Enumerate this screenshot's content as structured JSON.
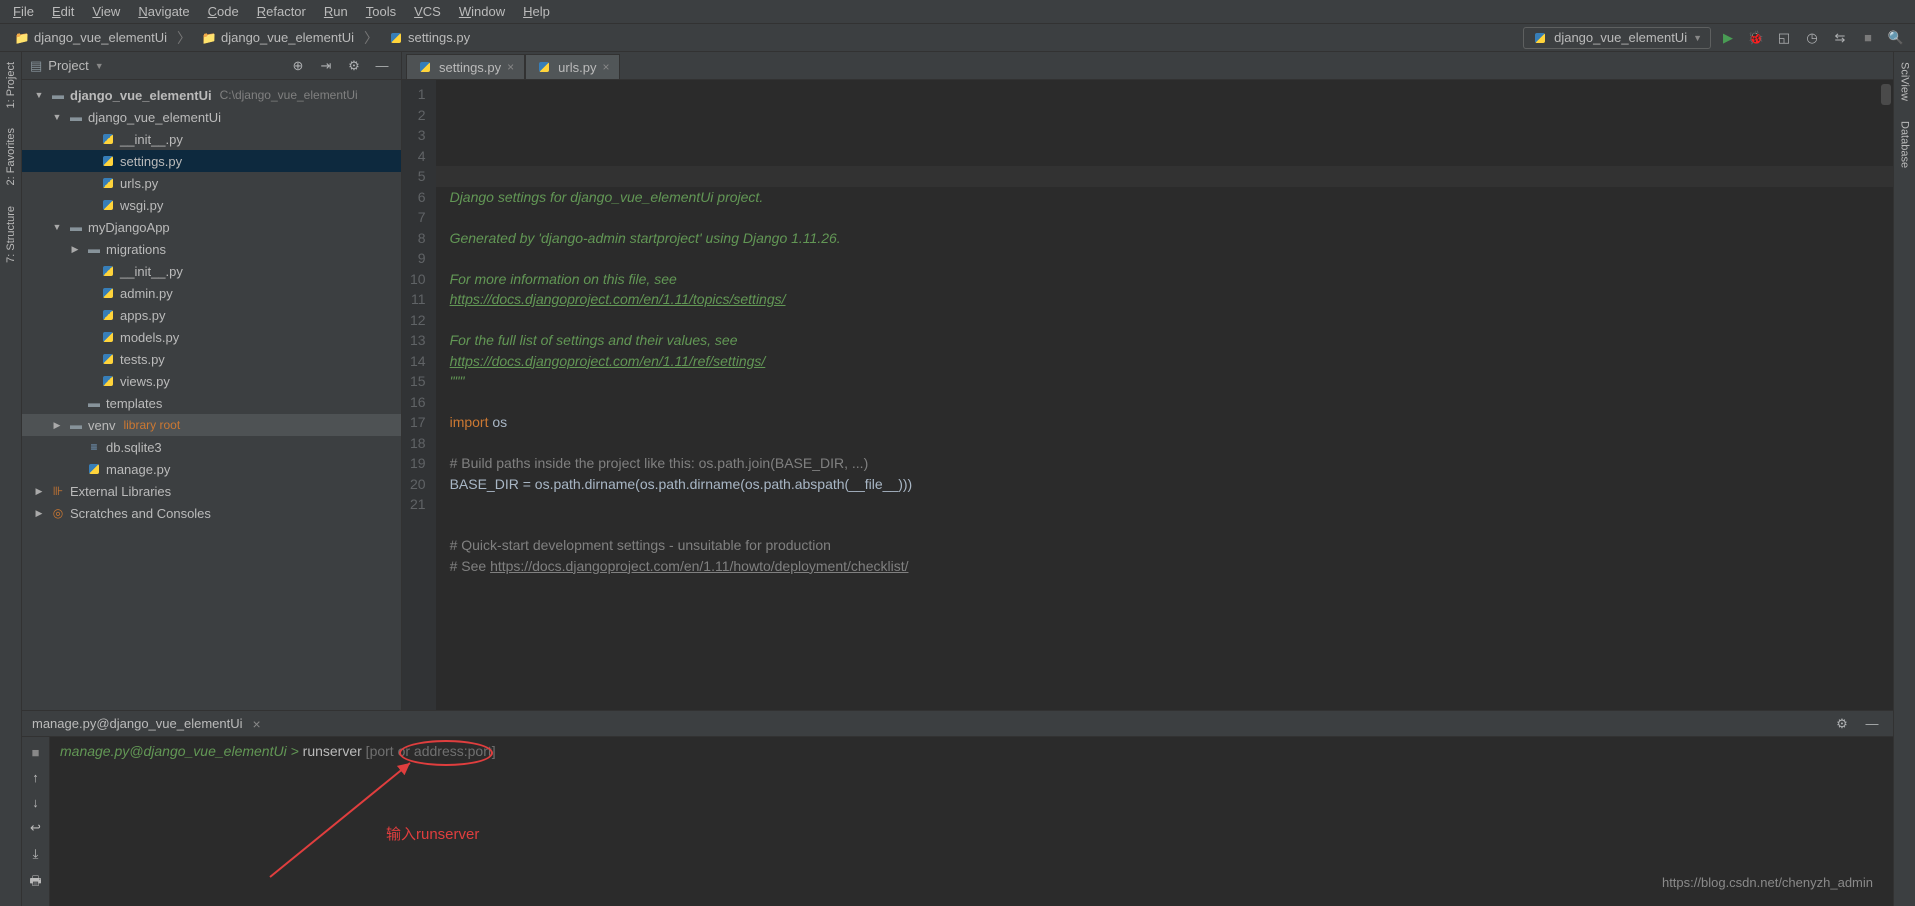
{
  "menu": [
    "File",
    "Edit",
    "View",
    "Navigate",
    "Code",
    "Refactor",
    "Run",
    "Tools",
    "VCS",
    "Window",
    "Help"
  ],
  "breadcrumbs": [
    {
      "label": "django_vue_elementUi",
      "icon": "folder"
    },
    {
      "label": "django_vue_elementUi",
      "icon": "folder"
    },
    {
      "label": "settings.py",
      "icon": "py"
    }
  ],
  "run_config": {
    "label": "django_vue_elementUi"
  },
  "project_panel": {
    "title": "Project",
    "tree": [
      {
        "pad": 10,
        "arrow": "▼",
        "icon": "folder-o",
        "label": "django_vue_elementUi",
        "extra_path": "C:\\django_vue_elementUi",
        "bold": true
      },
      {
        "pad": 28,
        "arrow": "▼",
        "icon": "folder-o",
        "label": "django_vue_elementUi"
      },
      {
        "pad": 60,
        "arrow": "",
        "icon": "py",
        "label": "__init__.py"
      },
      {
        "pad": 60,
        "arrow": "",
        "icon": "py",
        "label": "settings.py",
        "selected": true
      },
      {
        "pad": 60,
        "arrow": "",
        "icon": "py",
        "label": "urls.py"
      },
      {
        "pad": 60,
        "arrow": "",
        "icon": "py",
        "label": "wsgi.py"
      },
      {
        "pad": 28,
        "arrow": "▼",
        "icon": "folder-o",
        "label": "myDjangoApp"
      },
      {
        "pad": 46,
        "arrow": "▶",
        "icon": "folder",
        "label": "migrations"
      },
      {
        "pad": 60,
        "arrow": "",
        "icon": "py",
        "label": "__init__.py"
      },
      {
        "pad": 60,
        "arrow": "",
        "icon": "py",
        "label": "admin.py"
      },
      {
        "pad": 60,
        "arrow": "",
        "icon": "py",
        "label": "apps.py"
      },
      {
        "pad": 60,
        "arrow": "",
        "icon": "py",
        "label": "models.py"
      },
      {
        "pad": 60,
        "arrow": "",
        "icon": "py",
        "label": "tests.py"
      },
      {
        "pad": 60,
        "arrow": "",
        "icon": "py",
        "label": "views.py"
      },
      {
        "pad": 46,
        "arrow": "",
        "icon": "folder",
        "label": "templates"
      },
      {
        "pad": 28,
        "arrow": "▶",
        "icon": "folder",
        "label": "venv",
        "extra_lib": "library root",
        "highl": true
      },
      {
        "pad": 46,
        "arrow": "",
        "icon": "db",
        "label": "db.sqlite3"
      },
      {
        "pad": 46,
        "arrow": "",
        "icon": "py",
        "label": "manage.py"
      },
      {
        "pad": 10,
        "arrow": "▶",
        "icon": "lib",
        "label": "External Libraries"
      },
      {
        "pad": 10,
        "arrow": "▶",
        "icon": "scratch",
        "label": "Scratches and Consoles"
      }
    ]
  },
  "editor_tabs": [
    {
      "label": "settings.py",
      "active": true,
      "icon": "py"
    },
    {
      "label": "urls.py",
      "active": false,
      "icon": "py"
    }
  ],
  "code": {
    "lines": [
      {
        "t": "\"\"\"",
        "cls": "c-str"
      },
      {
        "t": "Django settings for django_vue_elementUi project.",
        "cls": "c-str"
      },
      {
        "t": "",
        "cls": ""
      },
      {
        "t": "Generated by 'django-admin startproject' using Django 1.11.26.",
        "cls": "c-str"
      },
      {
        "t": "",
        "cls": ""
      },
      {
        "t": "For more information on this file, see",
        "cls": "c-str"
      },
      {
        "t": "https://docs.djangoproject.com/en/1.11/topics/settings/",
        "cls": "c-link"
      },
      {
        "t": "",
        "cls": ""
      },
      {
        "t": "For the full list of settings and their values, see",
        "cls": "c-str"
      },
      {
        "t": "https://docs.djangoproject.com/en/1.11/ref/settings/",
        "cls": "c-link"
      },
      {
        "t": "\"\"\"",
        "cls": "c-str"
      },
      {
        "t": "",
        "cls": ""
      },
      {
        "html": "<span class='c-kw'>import </span>os"
      },
      {
        "t": "",
        "cls": ""
      },
      {
        "html": "<span class='c-comm'># Build paths inside the project like this: os.path.join(BASE_DIR, ...)</span>"
      },
      {
        "html": "BASE_DIR = os.path.dirname(os.path.dirname(os.path.abspath(__file__)))"
      },
      {
        "t": "",
        "cls": ""
      },
      {
        "t": "",
        "cls": ""
      },
      {
        "html": "<span class='c-comm'># Quick-start development settings - unsuitable for production</span>"
      },
      {
        "html": "<span class='c-comm'># See </span><span class='c-commlink'>https://docs.djangoproject.com/en/1.11/howto/deployment/checklist/</span>"
      },
      {
        "t": "",
        "cls": ""
      }
    ]
  },
  "terminal": {
    "tab_label": "manage.py@django_vue_elementUi",
    "prompt": "manage.py@django_vue_elementUi > ",
    "command": "runserver",
    "hint": " [port or address:port]",
    "annotation": "输入runserver"
  },
  "left_tabs": [
    "1: Project",
    "2: Favorites",
    "7: Structure"
  ],
  "right_tabs": [
    "SciView",
    "Database"
  ],
  "watermark": "https://blog.csdn.net/chenyzh_admin"
}
